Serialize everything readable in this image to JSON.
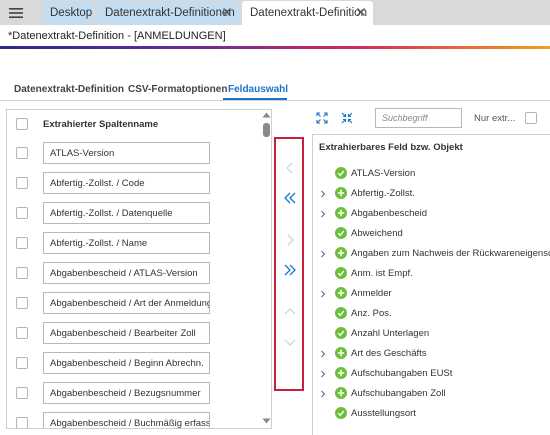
{
  "window": {
    "tabs": [
      {
        "label": "Desktop",
        "closable": false,
        "active": false
      },
      {
        "label": "Datenextrakt-Definitionen",
        "closable": true,
        "active": false
      },
      {
        "label": "Datenextrakt-Definition",
        "closable": true,
        "active": true
      }
    ]
  },
  "page": {
    "title": "*Datenextrakt-Definition - [ANMELDUNGEN]"
  },
  "section_tabs": [
    {
      "label": "Datenextrakt-Definition",
      "active": false
    },
    {
      "label": "CSV-Formatoptionen",
      "active": false
    },
    {
      "label": "Feldauswahl",
      "active": true
    }
  ],
  "left_panel": {
    "header": "Extrahierter Spaltenname",
    "rows": [
      "ATLAS-Version",
      "Abfertig.-Zollst. / Code",
      "Abfertig.-Zollst. / Datenquelle",
      "Abfertig.-Zollst. / Name",
      "Abgabenbescheid / ATLAS-Version",
      "Abgabenbescheid / Art der Anmeldung",
      "Abgabenbescheid / Bearbeiter Zoll",
      "Abgabenbescheid / Beginn Abrechn.",
      "Abgabenbescheid / Bezugsnummer",
      "Abgabenbescheid / Buchmäßig erfasst"
    ]
  },
  "right_panel": {
    "search_placeholder": "Suchbegriff",
    "only_extracted_label": "Nur extr...",
    "header": "Extrahierbares Feld bzw. Objekt",
    "items": [
      {
        "label": "ATLAS-Version",
        "expandable": false,
        "icon": "check"
      },
      {
        "label": "Abfertig.-Zollst.",
        "expandable": true,
        "icon": "plus"
      },
      {
        "label": "Abgabenbescheid",
        "expandable": true,
        "icon": "plus"
      },
      {
        "label": "Abweichend",
        "expandable": false,
        "icon": "check"
      },
      {
        "label": "Angaben zum Nachweis der Rückwareneigenschaft",
        "expandable": true,
        "icon": "plus"
      },
      {
        "label": "Anm. ist Empf.",
        "expandable": false,
        "icon": "check"
      },
      {
        "label": "Anmelder",
        "expandable": true,
        "icon": "plus"
      },
      {
        "label": "Anz. Pos.",
        "expandable": false,
        "icon": "check"
      },
      {
        "label": "Anzahl Unterlagen",
        "expandable": false,
        "icon": "check"
      },
      {
        "label": "Art des Geschäfts",
        "expandable": true,
        "icon": "plus"
      },
      {
        "label": "Aufschubangaben EUSt",
        "expandable": true,
        "icon": "plus"
      },
      {
        "label": "Aufschubangaben Zoll",
        "expandable": true,
        "icon": "plus"
      },
      {
        "label": "Ausstellungsort",
        "expandable": false,
        "icon": "check"
      }
    ]
  },
  "colors": {
    "accent": "#1a74c8",
    "success": "#6bbf3a",
    "highlight_border": "#cc1f3c"
  }
}
